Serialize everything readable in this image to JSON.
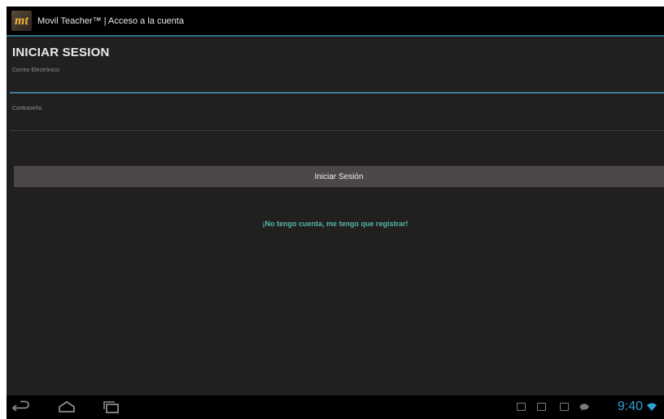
{
  "app": {
    "icon_text": "mt",
    "title": "Movil Teacher™ | Acceso a la cuenta"
  },
  "form": {
    "heading": "INICIAR SESION",
    "email_label": "Correo Electrónico",
    "email_value": "",
    "password_label": "Contraseña",
    "password_value": "",
    "login_button": "Iniciar Sesión",
    "register_link": "¡No tengo cuenta, me tengo que registrar!"
  },
  "system_bar": {
    "clock": "9:40",
    "nav_icons": [
      "back-icon",
      "home-icon",
      "recents-icon"
    ],
    "status_icons": [
      "gallery-icon",
      "mail-icon",
      "briefcase-icon",
      "chat-icon",
      "wifi-icon"
    ]
  },
  "colors": {
    "background": "#221f1f",
    "action_bar": "#000000",
    "accent_line": "#2d6f8a",
    "button": "#4d4646",
    "link": "#52b8a9",
    "clock": "#2f9fd1"
  }
}
